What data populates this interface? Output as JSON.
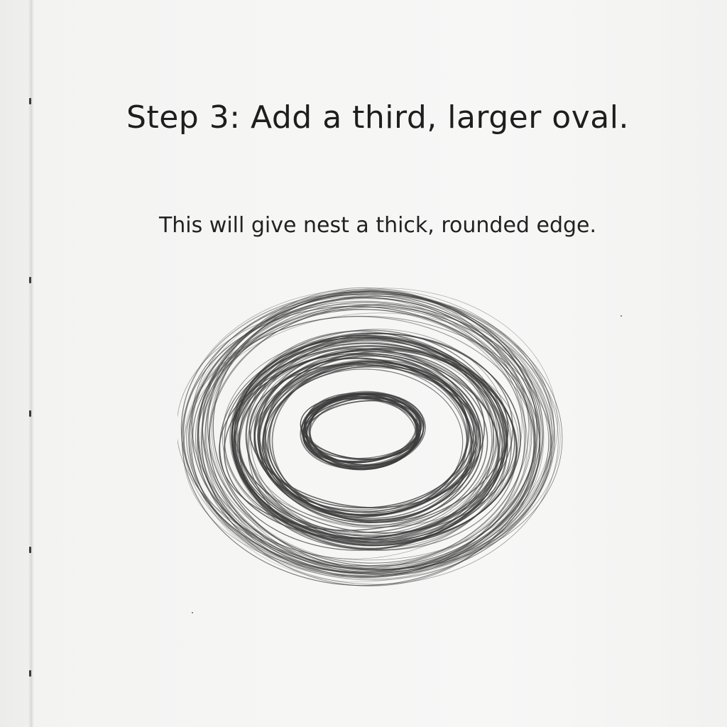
{
  "page": {
    "heading": "Step 3: Add a third, larger oval.",
    "description": "This will give nest a thick, rounded edge."
  },
  "illustration": {
    "subject": "pencil-scribbled-nest",
    "stroke_color": "#3c3c3c"
  },
  "colors": {
    "paper": "#f5f5f4",
    "ink": "#1e1e1e",
    "binding": "#3a3a3a"
  }
}
